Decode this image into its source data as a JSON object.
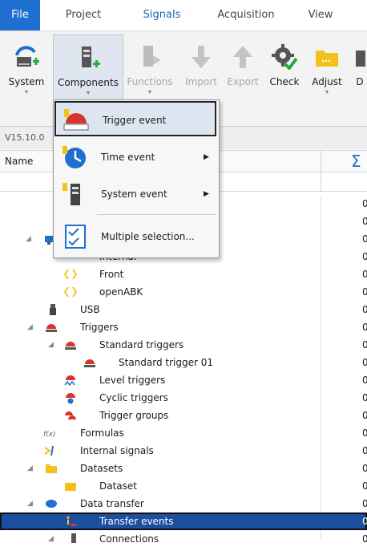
{
  "tabs": {
    "file": "File",
    "project": "Project",
    "signals": "Signals",
    "acquisition": "Acquisition",
    "view": "View"
  },
  "ribbon": {
    "system": "System",
    "components": "Components",
    "functions": "Functions",
    "import": "Import",
    "export": "Export",
    "check": "Check",
    "adjust": "Adjust",
    "cut_label": "D",
    "dropdown_glyph": "▾"
  },
  "version": "V15.10.0",
  "columns": {
    "name": "Name",
    "sum": "Σ"
  },
  "menu": {
    "trigger_event": "Trigger event",
    "time_event": "Time event",
    "system_event": "System event",
    "multiple_selection": "Multiple selection...",
    "submenu_glyph": "▶"
  },
  "tree": {
    "internal": "Internal",
    "front": "Front",
    "openabk": "openABK",
    "usb": "USB",
    "triggers": "Triggers",
    "standard_triggers": "Standard triggers",
    "standard_trigger_01": "Standard trigger 01",
    "level_triggers": "Level triggers",
    "cyclic_triggers": "Cyclic triggers",
    "trigger_groups": "Trigger groups",
    "formulas": "Formulas",
    "internal_signals": "Internal signals",
    "datasets": "Datasets",
    "dataset": "Dataset",
    "data_transfer": "Data transfer",
    "transfer_events": "Transfer events",
    "connections": "Connections",
    "expander_glyph": "◢",
    "zero": "0"
  },
  "colors": {
    "accent": "#1e6fd0",
    "selection": "#1c4fa0",
    "trigger_red": "#d9342b",
    "folder_yellow": "#f2c21b",
    "check_green": "#2faa3c"
  }
}
